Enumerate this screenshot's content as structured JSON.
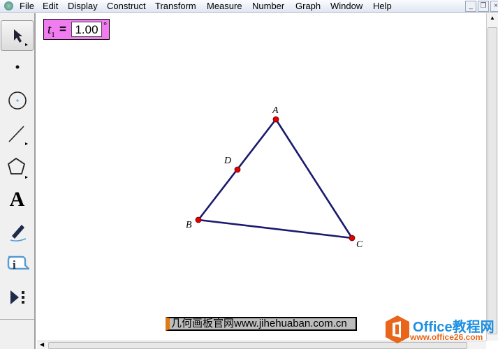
{
  "menubar": {
    "items": [
      "File",
      "Edit",
      "Display",
      "Construct",
      "Transform",
      "Measure",
      "Number",
      "Graph",
      "Window",
      "Help"
    ]
  },
  "toolbox": {
    "tools": [
      "arrow-tool",
      "point-tool",
      "compass-tool",
      "straightedge-tool",
      "polygon-tool",
      "text-tool",
      "marker-tool",
      "information-tool",
      "custom-tools"
    ]
  },
  "parameter": {
    "name": "t",
    "subscript": "1",
    "equals": "=",
    "value": "1.00",
    "unit": "°",
    "color": "#f07cf0"
  },
  "figure": {
    "points": {
      "A": "A",
      "B": "B",
      "C": "C",
      "D": "D"
    },
    "line_color": "#1a1a6e",
    "point_color": "#e00000"
  },
  "watermark": {
    "text": "几何画板官网www.jihehuaban.com.cn"
  },
  "logo": {
    "title": "Office教程网",
    "url": "www.office26.com"
  }
}
